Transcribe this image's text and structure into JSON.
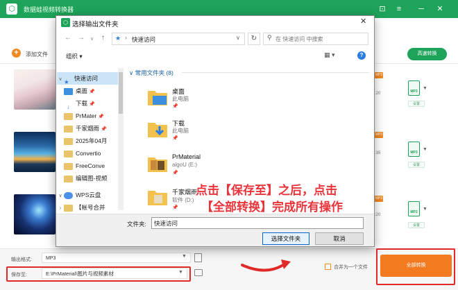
{
  "app": {
    "title": "数据蛙视频转换器",
    "logo_glyph": "⬡",
    "add_file": "添加文件",
    "hq_convert": "高速转换",
    "format_badge": "MP3",
    "settings_chip": "设置",
    "orange_tag": "MP3",
    "durations": [
      ":20",
      ":35",
      ":20"
    ],
    "output_format_label": "输出格式:",
    "output_format_value": "MP3",
    "save_to_label": "保存至:",
    "save_to_value": "E:\\PrMaterial\\图片与视频素材",
    "merge_label": "合并为一个文件",
    "convert_all": "全部转换"
  },
  "dialog": {
    "title": "选择输出文件夹",
    "address": "快速访问",
    "search_placeholder": "在 快速访问 中搜索",
    "organize": "组织 ▾",
    "nav_items": [
      {
        "label": "快速访问",
        "icon": "star-icon"
      },
      {
        "label": "桌面",
        "icon": "desktop-folder-icon"
      },
      {
        "label": "下载",
        "icon": "download-folder-icon"
      },
      {
        "label": "PrMater",
        "icon": "folder-icon"
      },
      {
        "label": "千家烟雨",
        "icon": "folder-icon"
      },
      {
        "label": "2025年04月",
        "icon": "folder-icon"
      },
      {
        "label": "Convertio",
        "icon": "folder-icon"
      },
      {
        "label": "FreeConve",
        "icon": "folder-icon"
      },
      {
        "label": "编辑图-视频",
        "icon": "folder-icon"
      },
      {
        "label": "WPS云盘",
        "icon": "cloud-icon"
      },
      {
        "label": "【帐号合并",
        "icon": "folder-icon"
      }
    ],
    "group_header": "常用文件夹 (8)",
    "items": [
      {
        "name": "桌面",
        "sub": "此电脑"
      },
      {
        "name": "下载",
        "sub": "此电脑"
      },
      {
        "name": "PrMaterial",
        "sub": "aigoU (E:)"
      },
      {
        "name": "千家烟雨",
        "sub": "软件 (D:)"
      }
    ],
    "folder_label": "文件夹:",
    "folder_value": "快速访问",
    "select_button": "选择文件夹",
    "cancel_button": "取消"
  },
  "annotation": {
    "line1": "点击【保存至】之后，点击",
    "line2": "【全部转换】完成所有操作"
  },
  "colors": {
    "brand": "#1ea35a",
    "accent": "#f47a20",
    "highlight": "#e02a2a"
  }
}
